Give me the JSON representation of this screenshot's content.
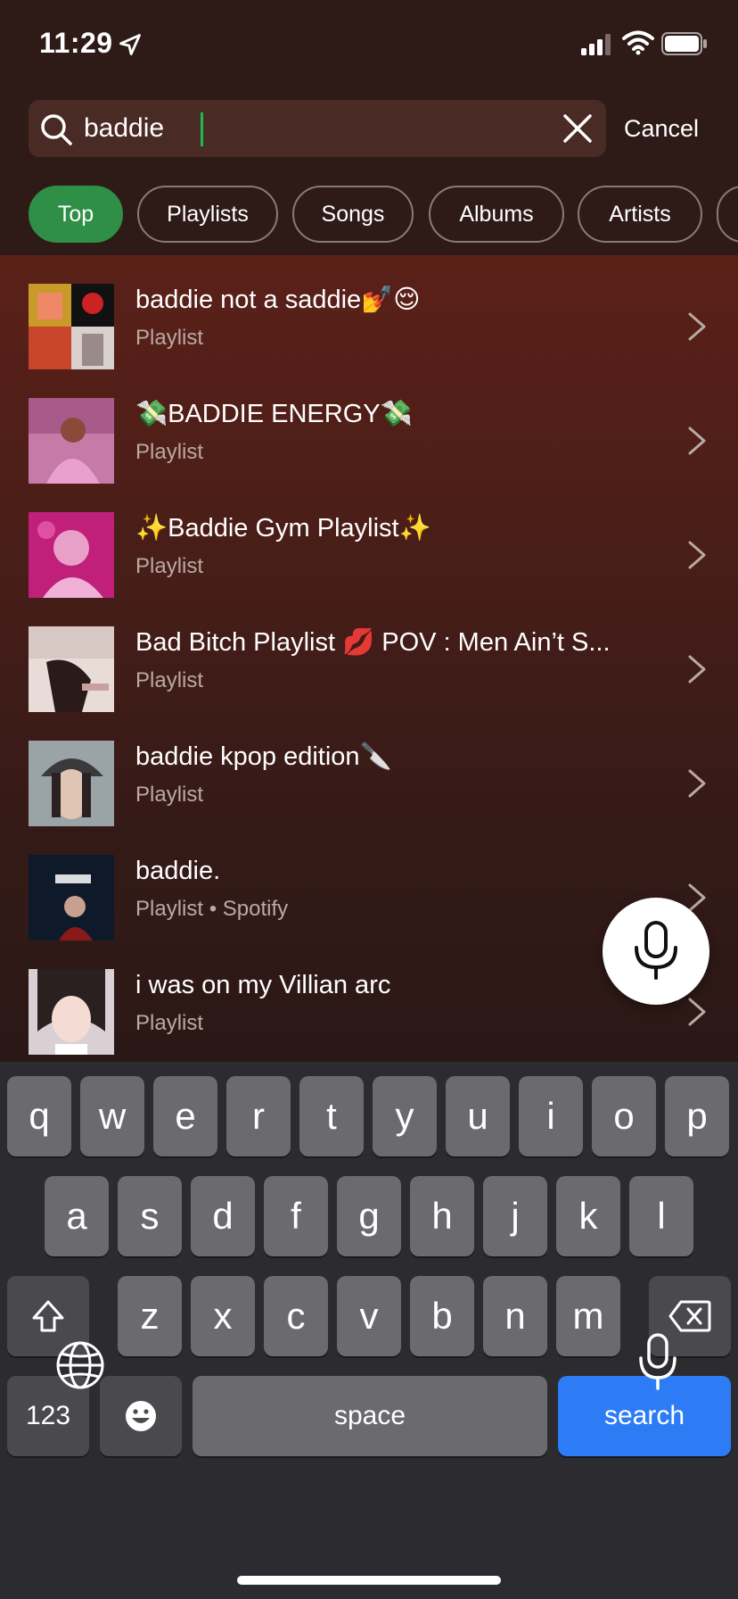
{
  "status_bar": {
    "time": "11:29"
  },
  "search": {
    "value": "baddie",
    "cancel_label": "Cancel"
  },
  "filters": [
    {
      "label": "Top",
      "active": true
    },
    {
      "label": "Playlists",
      "active": false
    },
    {
      "label": "Songs",
      "active": false
    },
    {
      "label": "Albums",
      "active": false
    },
    {
      "label": "Artists",
      "active": false
    }
  ],
  "results": [
    {
      "title": "baddie not a saddie💅😌",
      "subtitle": "Playlist"
    },
    {
      "title": "💸BADDIE ENERGY💸",
      "subtitle": "Playlist"
    },
    {
      "title": "✨Baddie Gym Playlist✨",
      "subtitle": "Playlist"
    },
    {
      "title": "Bad Bitch Playlist 💋 POV : Men Ain’t S...",
      "subtitle": "Playlist"
    },
    {
      "title": "baddie kpop edition🔪",
      "subtitle": "Playlist"
    },
    {
      "title": "baddie.",
      "subtitle": "Playlist • Spotify"
    },
    {
      "title": "i was on my Villian arc",
      "subtitle": "Playlist"
    }
  ],
  "keyboard": {
    "row1": [
      "q",
      "w",
      "e",
      "r",
      "t",
      "y",
      "u",
      "i",
      "o",
      "p"
    ],
    "row2": [
      "a",
      "s",
      "d",
      "f",
      "g",
      "h",
      "j",
      "k",
      "l"
    ],
    "row3": [
      "z",
      "x",
      "c",
      "v",
      "b",
      "n",
      "m"
    ],
    "numbers_label": "123",
    "space_label": "space",
    "search_label": "search"
  },
  "colors": {
    "accent_green": "#2f8f46",
    "caret_green": "#1db954",
    "search_key_blue": "#2d7cf6"
  },
  "icons": [
    "location-arrow-icon",
    "signal-icon",
    "wifi-icon",
    "battery-icon",
    "search-icon",
    "clear-icon",
    "chevron-right-icon",
    "microphone-icon",
    "shift-icon",
    "backspace-icon",
    "emoji-icon",
    "globe-icon",
    "dictation-icon"
  ]
}
